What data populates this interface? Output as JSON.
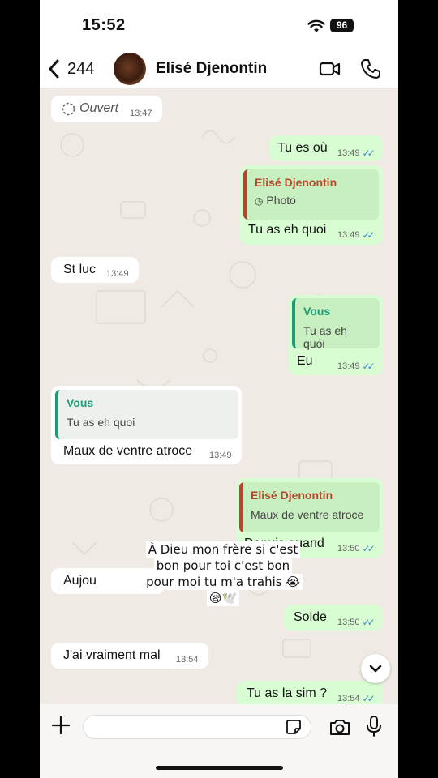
{
  "status_bar": {
    "time": "15:52",
    "battery": "96"
  },
  "header": {
    "back_count": "244",
    "contact_name": "Elisé Djenontin"
  },
  "messages": [
    {
      "dir": "in",
      "text": "Ouvert",
      "time": "13:47"
    },
    {
      "dir": "out",
      "text": "Tu es où",
      "time": "13:49"
    },
    {
      "dir": "out",
      "quote_author": "Elisé Djenontin",
      "quote_text": "Photo",
      "text": "Tu as eh quoi",
      "time": "13:49"
    },
    {
      "dir": "in",
      "text": "St luc",
      "time": "13:49"
    },
    {
      "dir": "out",
      "quote_author": "Vous",
      "quote_text": "Tu as eh quoi",
      "text": "Eu",
      "time": "13:49"
    },
    {
      "dir": "in",
      "quote_author": "Vous",
      "quote_text": "Tu as eh quoi",
      "text": "Maux de ventre atroce",
      "time": "13:49"
    },
    {
      "dir": "out",
      "quote_author": "Elisé Djenontin",
      "quote_text": "Maux de ventre atroce",
      "text": "Depuis quand",
      "time": "13:50"
    },
    {
      "dir": "in",
      "text": "Aujou",
      "time": ""
    },
    {
      "dir": "out",
      "text": "Solde",
      "time": "13:50"
    },
    {
      "dir": "in",
      "text": "J'ai vraiment mal",
      "time": "13:54"
    },
    {
      "dir": "out",
      "text": "Tu as la sim ?",
      "time": "13:54"
    }
  ],
  "overlay": {
    "line1": "À Dieu mon frère si c'est",
    "line2": "bon pour toi c'est bon",
    "line3": "pour moi tu m'a trahis 😭",
    "line4": "😪🕊️"
  },
  "colors": {
    "outgoing": "#d9fdd3",
    "incoming": "#ffffff",
    "tick_blue": "#3a8bd8",
    "quote_green": "#1a9c77",
    "quote_red": "#b3472c"
  }
}
